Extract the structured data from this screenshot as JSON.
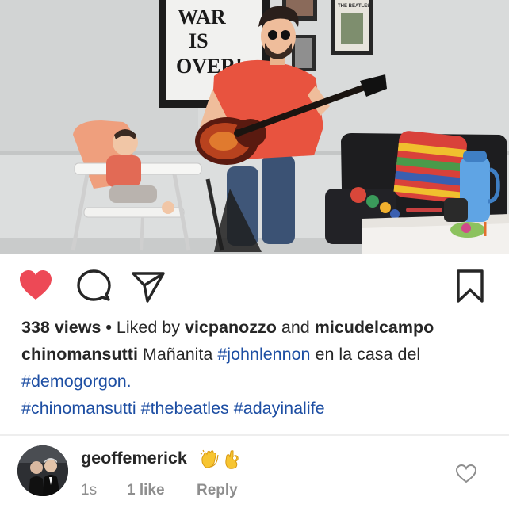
{
  "colors": {
    "like_active": "#ed4956",
    "hashtag": "#1d4ea3",
    "muted": "#8e8e8e",
    "text": "#262626"
  },
  "photo": {
    "poster_text": [
      "WAR",
      "IS",
      "OVER!"
    ],
    "small_poster_text": "THE BEATLES"
  },
  "actions": {
    "like_icon": "heart-filled-icon",
    "comment_icon": "comment-bubble-icon",
    "share_icon": "paper-plane-icon",
    "save_icon": "bookmark-icon"
  },
  "post": {
    "views": "338 views",
    "separator": "•",
    "liked_by_prefix": "Liked by",
    "liked_by_user_1": "vicpanozzo",
    "liked_by_and": "and",
    "liked_by_user_2": "micudelcampo",
    "author": "chinomansutti",
    "caption_text_1": "Mañanita",
    "hashtag_1": "#johnlennon",
    "caption_text_2": "en la casa del",
    "hashtag_2": "#demogorgon.",
    "hashtag_3": "#chinomansutti",
    "hashtag_4": "#thebeatles",
    "hashtag_5": "#adayinalife"
  },
  "comment": {
    "username": "geoffemerick",
    "emojis": [
      "clapping-hands-icon",
      "ok-hand-icon"
    ],
    "time": "1s",
    "likes": "1 like",
    "reply": "Reply",
    "like_icon": "heart-outline-icon"
  }
}
